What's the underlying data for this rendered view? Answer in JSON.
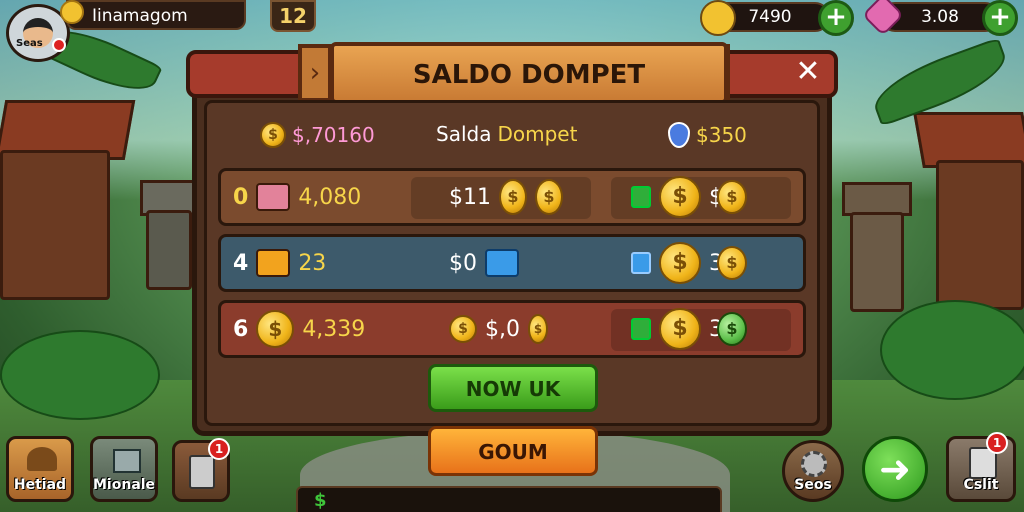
{
  "player": {
    "avatar_label": "Seas",
    "name": "Iinamagom",
    "level": "12"
  },
  "resources": [
    {
      "icon": "gold-coin-icon",
      "value": "7490",
      "color": "#f2c230"
    },
    {
      "icon": "pink-gem-icon",
      "value": "3.08",
      "color": "#e26ab0"
    }
  ],
  "dialog": {
    "title": "SALDO DOMPET",
    "summary": {
      "left_value": "$,70160",
      "center_label_1": "Salda",
      "center_label_2": "Dompet",
      "right_value": "$350"
    },
    "rows": [
      {
        "index": "0",
        "item_icon": "pink-box-icon",
        "item_value": "4,080",
        "price": "$11",
        "reward_icon": "green-bag-icon",
        "reward_value": "$",
        "color": "#7b4b2e"
      },
      {
        "index": "4",
        "item_icon": "orange-chest-icon",
        "item_value": "23",
        "price": "$0",
        "reward_icon": "blue-bag-icon",
        "reward_value": "3",
        "color": "#3d5a6b"
      },
      {
        "index": "6",
        "item_icon": "gold-coin-icon",
        "item_value": "4,339",
        "price": "$,0",
        "reward_icon": "green-bag-icon",
        "reward_value": "3",
        "color": "#8b3c2c"
      }
    ],
    "primary_button": "NOW UK",
    "secondary_button": "GOUM"
  },
  "bottom_bar": {
    "label": "$"
  },
  "corner_buttons": {
    "left": [
      {
        "label": "Hetiad",
        "icon": "hat-icon"
      },
      {
        "label": "Mionale",
        "icon": "house-icon"
      },
      {
        "label": "",
        "icon": "cup-icon",
        "badge": "1"
      }
    ],
    "right": [
      {
        "label": "Seos",
        "icon": "gear-icon"
      },
      {
        "label": "",
        "icon": "arrow-right-icon"
      },
      {
        "label": "Cslit",
        "icon": "clipboard-icon",
        "badge": "1"
      }
    ]
  }
}
